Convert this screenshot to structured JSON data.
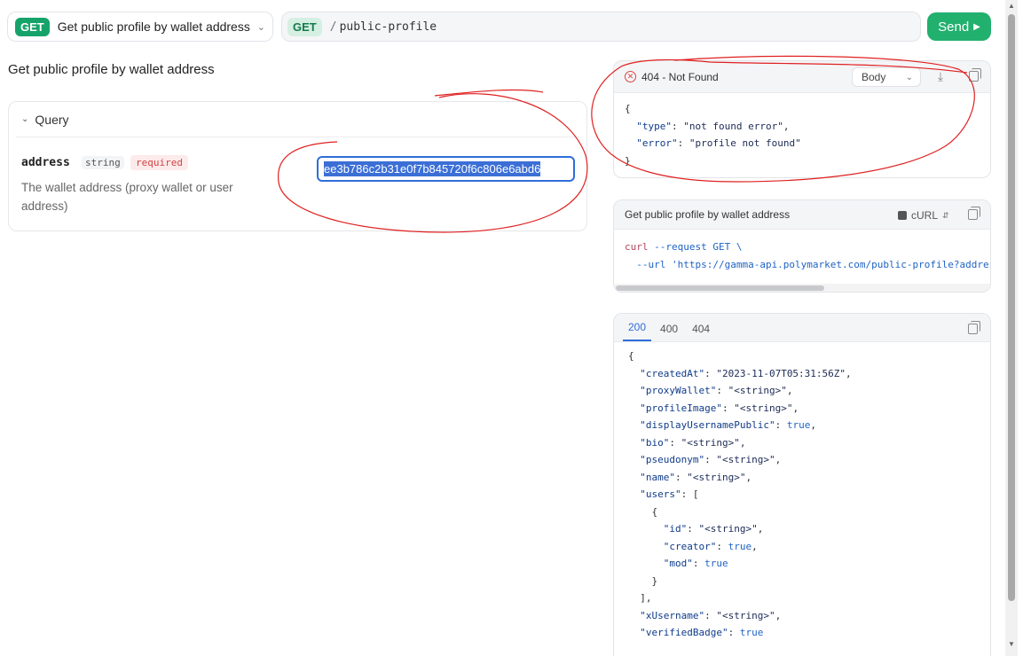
{
  "top_bar": {
    "method": "GET",
    "endpoint_title": "Get public profile by wallet address",
    "url_method": "GET",
    "url_slash": "/",
    "url_path": "public-profile",
    "send_label": "Send"
  },
  "page_title": "Get public profile by wallet address",
  "query": {
    "section_label": "Query",
    "param_name": "address",
    "param_type": "string",
    "param_required": "required",
    "param_description": "The wallet address (proxy wallet or user address)",
    "param_value": "ee3b786c2b31e0f7b845720f6c806e6abd6"
  },
  "response_card": {
    "status": "404 - Not Found",
    "view_select": "Body",
    "body_lines": [
      "{",
      "  \"type\": \"not found error\",",
      "  \"error\": \"profile not found\"",
      "}"
    ]
  },
  "request_card": {
    "title": "Get public profile by wallet address",
    "language": "cURL",
    "line1_cmd": "curl",
    "line1_rest": " --request GET \\",
    "line2": "  --url 'https://gamma-api.polymarket.com/public-profile?address"
  },
  "example_card": {
    "tabs": [
      "200",
      "400",
      "404"
    ],
    "active_tab": "200",
    "lines": [
      "{",
      "  \"createdAt\": \"2023-11-07T05:31:56Z\",",
      "  \"proxyWallet\": \"<string>\",",
      "  \"profileImage\": \"<string>\",",
      "  \"displayUsernamePublic\": true,",
      "  \"bio\": \"<string>\",",
      "  \"pseudonym\": \"<string>\",",
      "  \"name\": \"<string>\",",
      "  \"users\": [",
      "    {",
      "      \"id\": \"<string>\",",
      "      \"creator\": true,",
      "      \"mod\": true",
      "    }",
      "  ],",
      "  \"xUsername\": \"<string>\",",
      "  \"verifiedBadge\": true"
    ]
  },
  "colors": {
    "accent_green": "#22b06e",
    "link_blue": "#2f6ed8",
    "error_red": "#d64545",
    "annotation_red": "#e02020"
  },
  "icons": [
    "chevron-down-icon",
    "play-icon",
    "error-circle-icon",
    "download-icon",
    "copy-icon",
    "terminal-icon",
    "sort-icon"
  ]
}
